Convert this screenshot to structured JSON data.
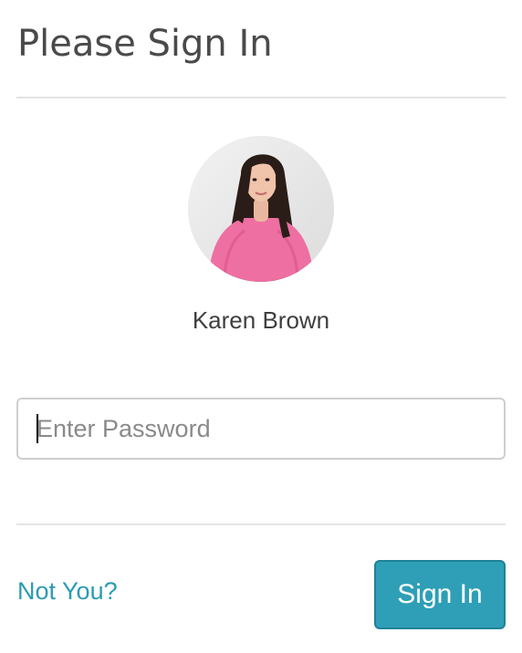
{
  "dialog": {
    "title": "Please Sign In"
  },
  "user": {
    "name": "Karen Brown",
    "avatar_icon": "user-avatar-photo"
  },
  "password": {
    "placeholder": "Enter Password",
    "value": ""
  },
  "actions": {
    "not_you_label": "Not You?",
    "sign_in_label": "Sign In"
  },
  "colors": {
    "accent": "#2e9fb6",
    "link": "#2b9bb3",
    "title": "#4a4a4a",
    "divider": "#e4e4e4"
  }
}
